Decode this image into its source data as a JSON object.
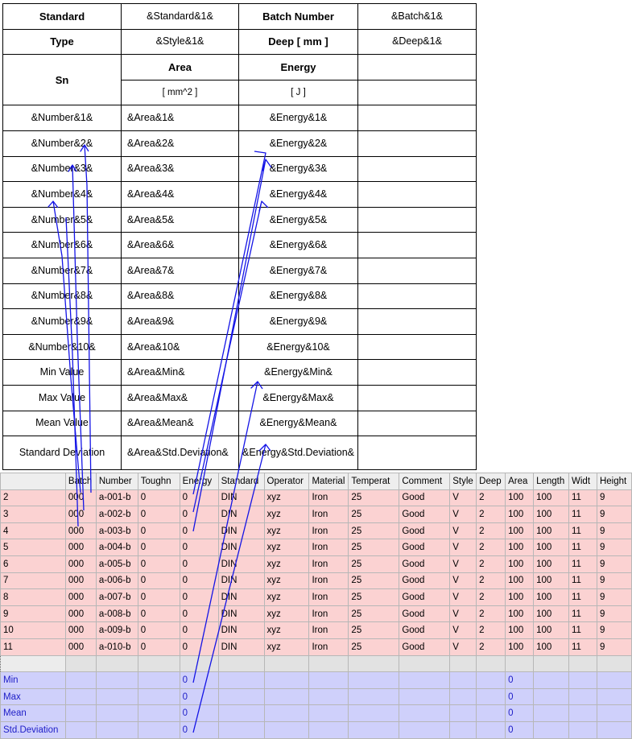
{
  "report": {
    "standard_label": "Standard",
    "standard_value": "&Standard&1&",
    "batch_label": "Batch Number",
    "batch_value": "&Batch&1&",
    "type_label": "Type",
    "type_value": "&Style&1&",
    "deep_label": "Deep [ mm ]",
    "deep_value": "&Deep&1&",
    "sn_label": "Sn",
    "area_label": "Area",
    "area_unit": "[ mm^2 ]",
    "energy_label": "Energy",
    "energy_unit": "[ J ]",
    "rows": [
      {
        "sn": "&Number&1&",
        "area": "&Area&1&",
        "energy": "&Energy&1&"
      },
      {
        "sn": "&Number&2&",
        "area": "&Area&2&",
        "energy": "&Energy&2&"
      },
      {
        "sn": "&Number&3&",
        "area": "&Area&3&",
        "energy": "&Energy&3&"
      },
      {
        "sn": "&Number&4&",
        "area": "&Area&4&",
        "energy": "&Energy&4&"
      },
      {
        "sn": "&Number&5&",
        "area": "&Area&5&",
        "energy": "&Energy&5&"
      },
      {
        "sn": "&Number&6&",
        "area": "&Area&6&",
        "energy": "&Energy&6&"
      },
      {
        "sn": "&Number&7&",
        "area": "&Area&7&",
        "energy": "&Energy&7&"
      },
      {
        "sn": "&Number&8&",
        "area": "&Area&8&",
        "energy": "&Energy&8&"
      },
      {
        "sn": "&Number&9&",
        "area": "&Area&9&",
        "energy": "&Energy&9&"
      },
      {
        "sn": "&Number&10&",
        "area": "&Area&10&",
        "energy": "&Energy&10&"
      },
      {
        "sn": "Min Value",
        "area": "&Area&Min&",
        "energy": "&Energy&Min&"
      },
      {
        "sn": "Max Value",
        "area": "&Area&Max&",
        "energy": "&Energy&Max&"
      },
      {
        "sn": "Mean Value",
        "area": "&Area&Mean&",
        "energy": "&Energy&Mean&"
      },
      {
        "sn": "Standard Deviation",
        "area": "&Area&Std.Deviation&",
        "energy": "&Energy&Std.Deviation&"
      }
    ]
  },
  "grid": {
    "columns": [
      "",
      "Batch",
      "Number",
      "Toughn",
      "Energy",
      "Standard",
      "Operator",
      "Material",
      "Temperat",
      "Comment",
      "Style",
      "Deep",
      "Area",
      "Length",
      "Widt",
      "Height"
    ],
    "rows": [
      [
        "2",
        "000",
        "a-001-b",
        "0",
        "0",
        "DIN",
        "xyz",
        "Iron",
        "25",
        "Good",
        "V",
        "2",
        "100",
        "100",
        "11",
        "9"
      ],
      [
        "3",
        "000",
        "a-002-b",
        "0",
        "0",
        "DIN",
        "xyz",
        "Iron",
        "25",
        "Good",
        "V",
        "2",
        "100",
        "100",
        "11",
        "9"
      ],
      [
        "4",
        "000",
        "a-003-b",
        "0",
        "0",
        "DIN",
        "xyz",
        "Iron",
        "25",
        "Good",
        "V",
        "2",
        "100",
        "100",
        "11",
        "9"
      ],
      [
        "5",
        "000",
        "a-004-b",
        "0",
        "0",
        "DIN",
        "xyz",
        "Iron",
        "25",
        "Good",
        "V",
        "2",
        "100",
        "100",
        "11",
        "9"
      ],
      [
        "6",
        "000",
        "a-005-b",
        "0",
        "0",
        "DIN",
        "xyz",
        "Iron",
        "25",
        "Good",
        "V",
        "2",
        "100",
        "100",
        "11",
        "9"
      ],
      [
        "7",
        "000",
        "a-006-b",
        "0",
        "0",
        "DIN",
        "xyz",
        "Iron",
        "25",
        "Good",
        "V",
        "2",
        "100",
        "100",
        "11",
        "9"
      ],
      [
        "8",
        "000",
        "a-007-b",
        "0",
        "0",
        "DIN",
        "xyz",
        "Iron",
        "25",
        "Good",
        "V",
        "2",
        "100",
        "100",
        "11",
        "9"
      ],
      [
        "9",
        "000",
        "a-008-b",
        "0",
        "0",
        "DIN",
        "xyz",
        "Iron",
        "25",
        "Good",
        "V",
        "2",
        "100",
        "100",
        "11",
        "9"
      ],
      [
        "10",
        "000",
        "a-009-b",
        "0",
        "0",
        "DIN",
        "xyz",
        "Iron",
        "25",
        "Good",
        "V",
        "2",
        "100",
        "100",
        "11",
        "9"
      ],
      [
        "11",
        "000",
        "a-010-b",
        "0",
        "0",
        "DIN",
        "xyz",
        "Iron",
        "25",
        "Good",
        "V",
        "2",
        "100",
        "100",
        "11",
        "9"
      ]
    ],
    "stats": [
      {
        "label": "Min",
        "energy": "0",
        "area": "0"
      },
      {
        "label": "Max",
        "energy": "0",
        "area": "0"
      },
      {
        "label": "Mean",
        "energy": "0",
        "area": "0"
      },
      {
        "label": "Std.Deviation",
        "energy": "0",
        "area": "0"
      }
    ]
  },
  "colors": {
    "arrow": "#1414e6",
    "data_row": "#fbd2d2",
    "stats_row": "#cfd0fb",
    "stats_text": "#2020c8"
  }
}
